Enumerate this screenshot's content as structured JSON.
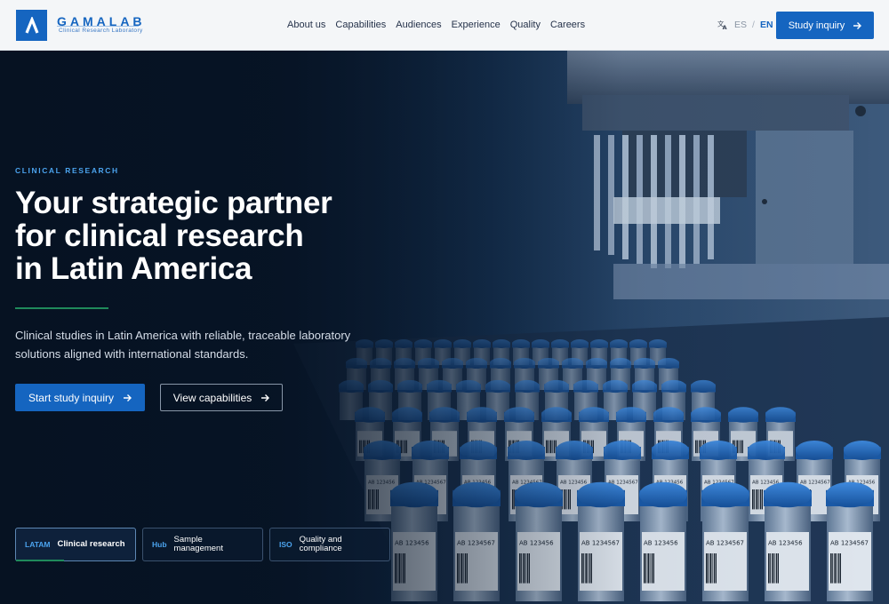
{
  "brand": {
    "name": "GAMALAB",
    "subtitle": "Clinical Research Laboratory",
    "logo_icon": "lambda-logo-icon"
  },
  "nav": {
    "items": [
      "About us",
      "Capabilities",
      "Audiences",
      "Experience",
      "Quality",
      "Careers"
    ]
  },
  "language": {
    "icon": "translate-icon",
    "options": [
      "ES",
      "EN"
    ],
    "separator": "/",
    "active": "EN"
  },
  "header_cta": {
    "label": "Study inquiry",
    "icon": "arrow-right-icon"
  },
  "hero": {
    "eyebrow": "CLINICAL RESEARCH",
    "headline": [
      "Your strategic partner",
      "for clinical research",
      "in Latin America"
    ],
    "lede": "Clinical studies in Latin America with reliable, traceable laboratory solutions aligned with international standards.",
    "primary_cta": "Start study inquiry",
    "secondary_cta": "View capabilities",
    "tags": [
      {
        "code": "LATAM",
        "label": "Clinical research",
        "active": true,
        "progress": 0.4
      },
      {
        "code": "Hub",
        "label": "Sample management",
        "active": false
      },
      {
        "code": "ISO",
        "label": "Quality and compliance",
        "label_lines": [
          "Quality and",
          "compliance"
        ],
        "active": false
      }
    ],
    "vial_label_text": [
      "AB 123456",
      "AB 1234567"
    ]
  },
  "colors": {
    "brand_blue": "#1565c0",
    "accent_blue": "#4ba3ee",
    "accent_green": "#1f8a5b",
    "hero_dark": "#08172b",
    "vial_cap": "#1f6fc9"
  }
}
